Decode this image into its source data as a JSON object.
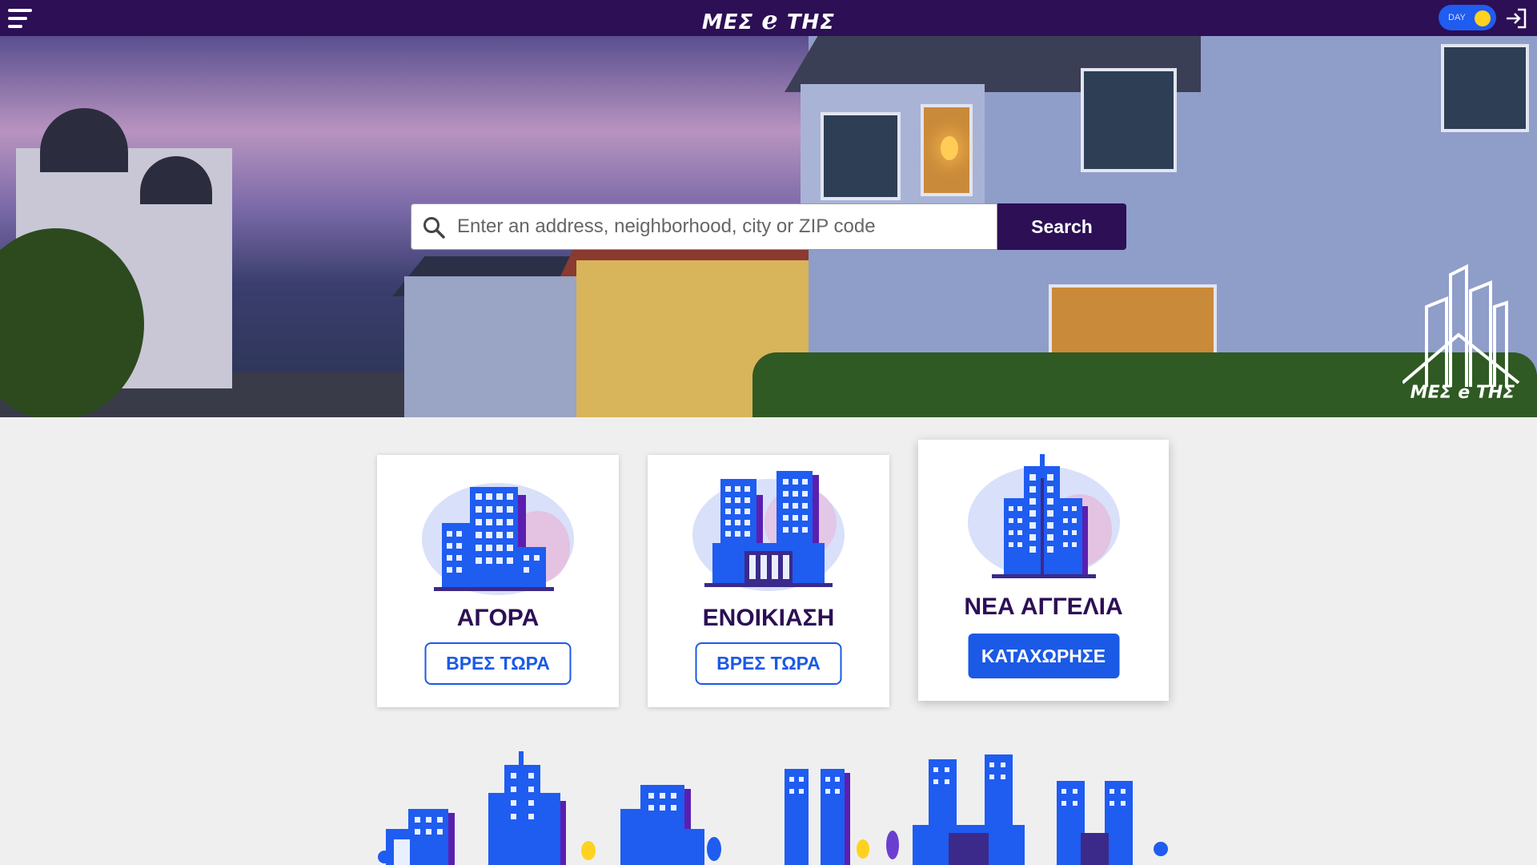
{
  "header": {
    "brand_left": "ΜΕΣ",
    "brand_mid": "e",
    "brand_right": "ΤΗΣ",
    "toggle_label": "DAY",
    "icons": {
      "menu": "hamburger-menu-icon",
      "login": "login-icon"
    }
  },
  "hero": {
    "search": {
      "placeholder": "Enter an address, neighborhood, city or ZIP code",
      "value": "",
      "button_label": "Search",
      "icon": "search-icon"
    },
    "logo_text": "ΜΕΣ e ΤΗΣ"
  },
  "cards": [
    {
      "title": "ΑΓΟΡΑ",
      "button": "ΒΡΕΣ ΤΩΡΑ"
    },
    {
      "title": "ΕΝΟΙΚΙΑΣΗ",
      "button": "ΒΡΕΣ ΤΩΡΑ"
    },
    {
      "title": "ΝΕΑ ΑΓΓΕΛΙΑ",
      "button": "ΚΑΤΑΧΩΡΗΣΕ"
    }
  ],
  "colors": {
    "header_bg": "#2c0f55",
    "accent_blue": "#1b5ae6",
    "building_blue": "#1f5cf0",
    "building_purple": "#5b1fb0",
    "toggle_knob": "#ffd21f",
    "page_bg": "#efefef"
  }
}
